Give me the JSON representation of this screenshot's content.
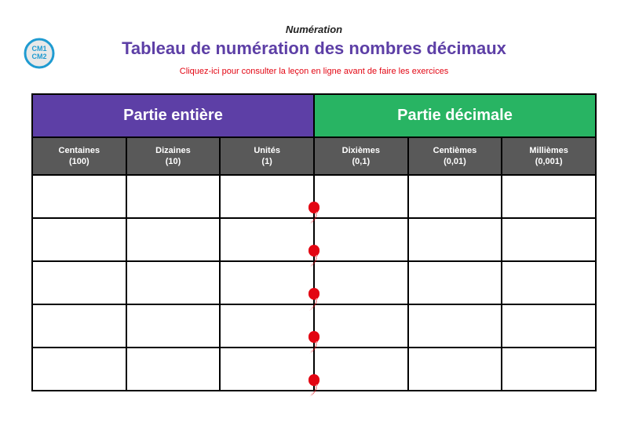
{
  "badge": {
    "line1": "CM1",
    "line2": "CM2"
  },
  "header": {
    "subject": "Numération",
    "title": "Tableau de numération des nombres décimaux",
    "lesson_link": "Cliquez-ici pour consulter la leçon en ligne avant de faire les exercices"
  },
  "table": {
    "integer_header": "Partie entière",
    "decimal_header": "Partie décimale",
    "columns": [
      {
        "label": "Centaines",
        "paren": "(100)"
      },
      {
        "label": "Dizaines",
        "paren": "(10)"
      },
      {
        "label": "Unités",
        "paren": "(1)"
      },
      {
        "label": "Dixièmes",
        "paren": "(0,1)"
      },
      {
        "label": "Centièmes",
        "paren": "(0,01)"
      },
      {
        "label": "Millièmes",
        "paren": "(0,001)"
      }
    ],
    "rows": 5
  },
  "colors": {
    "integer_bg": "#5d3fa6",
    "decimal_bg": "#28b463",
    "subheader_bg": "#595959",
    "comma": "#e30613"
  }
}
